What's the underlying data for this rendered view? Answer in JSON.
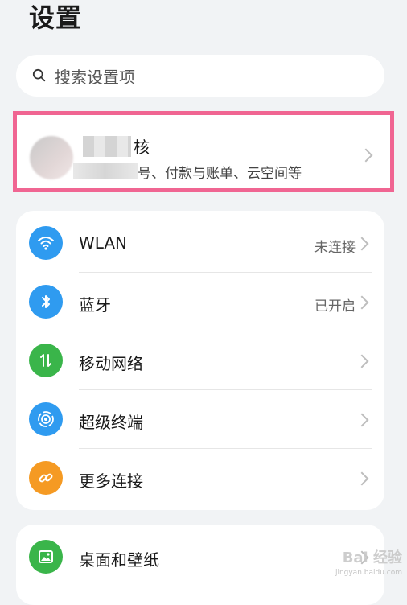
{
  "header": {
    "title": "设置"
  },
  "search": {
    "placeholder": "搜索设置项",
    "icon": "search-icon"
  },
  "account": {
    "name_visible": "核",
    "subtitle_visible": "号、付款与账单、云空间等"
  },
  "connectivity": {
    "items": [
      {
        "label": "WLAN",
        "status": "未连接",
        "icon": "wifi-icon",
        "color": "#2f9bf0"
      },
      {
        "label": "蓝牙",
        "status": "已开启",
        "icon": "bluetooth-icon",
        "color": "#2f9bf0"
      },
      {
        "label": "移动网络",
        "status": "",
        "icon": "mobile-data-icon",
        "color": "#3ab54a"
      },
      {
        "label": "超级终端",
        "status": "",
        "icon": "super-device-icon",
        "color": "#2f9bf0"
      },
      {
        "label": "更多连接",
        "status": "",
        "icon": "link-icon",
        "color": "#f59a23"
      }
    ]
  },
  "display": {
    "items": [
      {
        "label": "桌面和壁纸",
        "icon": "wallpaper-icon",
        "color": "#3ab54a"
      }
    ]
  },
  "watermark": {
    "logo": "Bai 经验",
    "url": "jingyan.baidu.com"
  }
}
